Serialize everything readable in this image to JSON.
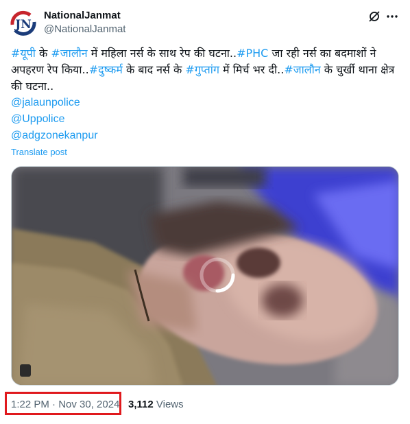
{
  "author": {
    "display_name": "NationalJanmat",
    "handle": "@NationalJanmat",
    "logo_text": "JN"
  },
  "header_icons": {
    "grok": "grok-icon",
    "more": "more-icon"
  },
  "tweet": {
    "segments": [
      {
        "text": "#यूपी",
        "tag": true
      },
      {
        "text": " के ",
        "tag": false
      },
      {
        "text": "#जालौन",
        "tag": true
      },
      {
        "text": " में महिला नर्स के साथ रेप की घटना..",
        "tag": false
      },
      {
        "text": "#PHC",
        "tag": true
      },
      {
        "text": " जा रही नर्स का बदमाशों ने अपहरण रेप किया..",
        "tag": false
      },
      {
        "text": "#दुष्कर्म",
        "tag": true
      },
      {
        "text": " के बाद नर्स के ",
        "tag": false
      },
      {
        "text": "#गुप्तांग",
        "tag": true
      },
      {
        "text": " में मिर्च भर दी..",
        "tag": false
      },
      {
        "text": "#जालौन",
        "tag": true
      },
      {
        "text": " के चुर्खी थाना क्षेत्र की घटना..",
        "tag": false
      }
    ],
    "mentions": [
      "@jalaunpolice",
      "@Uppolice",
      "@adgzonekanpur"
    ],
    "translate_label": "Translate post"
  },
  "footer": {
    "timestamp": "1:22 PM · Nov 30, 2024",
    "views_count": "3,112",
    "views_label": " Views"
  },
  "colors": {
    "link": "#1d9bf0",
    "muted": "#536471",
    "highlight_box": "#e0191d"
  }
}
